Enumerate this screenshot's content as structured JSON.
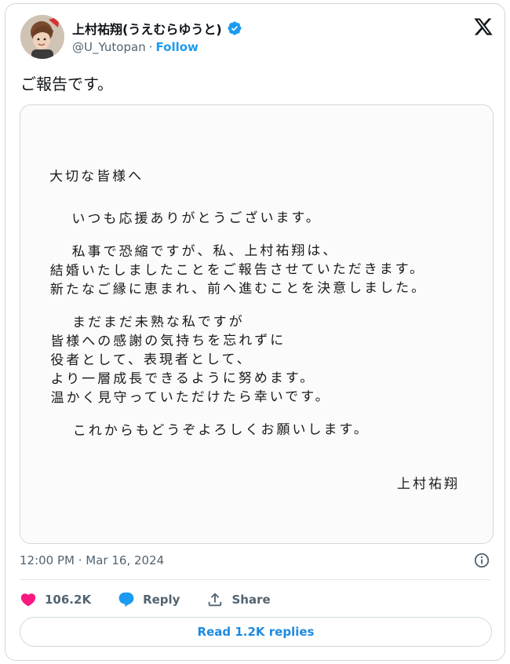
{
  "author": {
    "name": "上村祐翔(うえむらゆうと)",
    "handle": "@U_Yutopan",
    "separator": "·",
    "follow_label": "Follow"
  },
  "tweet": {
    "text": "ご報告です。",
    "timestamp": "12:00 PM · Mar 16, 2024"
  },
  "letter": {
    "greeting": "大切な皆様へ",
    "lines_p1": [
      "いつも応援ありがとうございます。"
    ],
    "lines_p2": [
      "私事で恐縮ですが、私、上村祐翔は、",
      "結婚いたしましたことをご報告させていただきます。",
      "新たなご縁に恵まれ、前へ進むことを決意しました。"
    ],
    "lines_p3": [
      "まだまだ未熟な私ですが",
      "皆様への感謝の気持ちを忘れずに",
      "役者として、表現者として、",
      "より一層成長できるように努めます。",
      "温かく見守っていただけたら幸いです。"
    ],
    "lines_p4": [
      "これからもどうぞよろしくお願いします。"
    ],
    "signature": "上村祐翔"
  },
  "actions": {
    "like_count": "106.2K",
    "reply_label": "Reply",
    "share_label": "Share"
  },
  "replies_button": "Read 1.2K replies",
  "colors": {
    "accent": "#1d9bf0",
    "like": "#f91880",
    "muted": "#536471"
  }
}
